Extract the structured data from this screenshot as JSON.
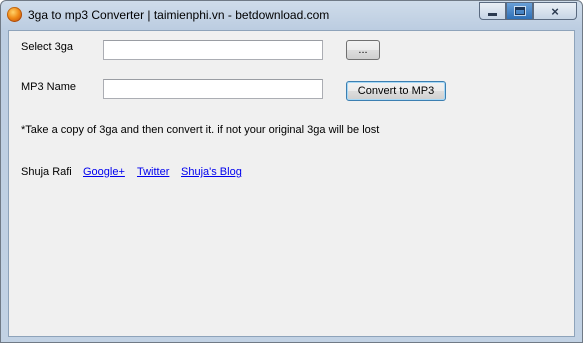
{
  "window": {
    "title": "3ga to mp3 Converter | taimienphi.vn - betdownload.com",
    "controls": {
      "minimize": "minimize",
      "maximize": "maximize",
      "close": "×"
    }
  },
  "form": {
    "select_label": "Select 3ga",
    "select_value": "",
    "browse_button": "...",
    "mp3_label": "MP3 Name",
    "mp3_value": "",
    "convert_button": "Convert to MP3",
    "note": "*Take a copy of 3ga and then convert it. if not your original 3ga will be lost"
  },
  "footer": {
    "author": "Shuja Rafi",
    "links": [
      "Google+",
      "Twitter",
      "Shuja's Blog"
    ]
  }
}
